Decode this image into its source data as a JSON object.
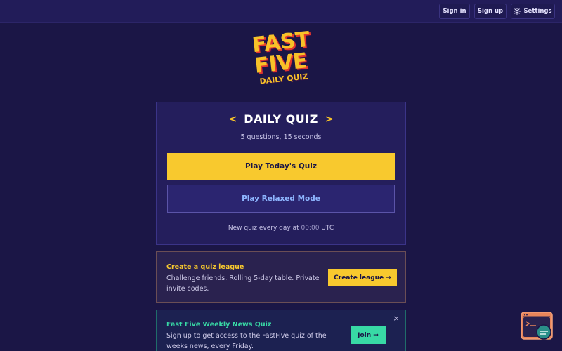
{
  "header": {
    "sign_in": "Sign in",
    "sign_up": "Sign up",
    "settings": "Settings",
    "settings_icon": "gear-icon"
  },
  "logo": {
    "line1": "FAST",
    "line2": "FIVE",
    "line3": "DAILY QUIZ"
  },
  "quiz_card": {
    "title": "DAILY QUIZ",
    "subtitle": "5 questions, 15 seconds",
    "play_button": "Play Today's Quiz",
    "relaxed_button": "Play Relaxed Mode",
    "note_prefix": "New quiz every day at ",
    "note_time": "00:00",
    "note_suffix": " UTC"
  },
  "league_card": {
    "heading": "Create a quiz league",
    "description": "Challenge friends. Rolling 5-day table. Private invite codes.",
    "button": "Create league →"
  },
  "news_card": {
    "heading": "Fast Five Weekly News Quiz",
    "description": "Sign up to get access to the FastFive quiz of the weeks news, every Friday.",
    "button": "Join →",
    "close": "×"
  },
  "colors": {
    "background": "#1b1646",
    "accent_yellow": "#f8c92e",
    "accent_green": "#38d9a5",
    "relaxed_text": "#8eb6ff"
  }
}
